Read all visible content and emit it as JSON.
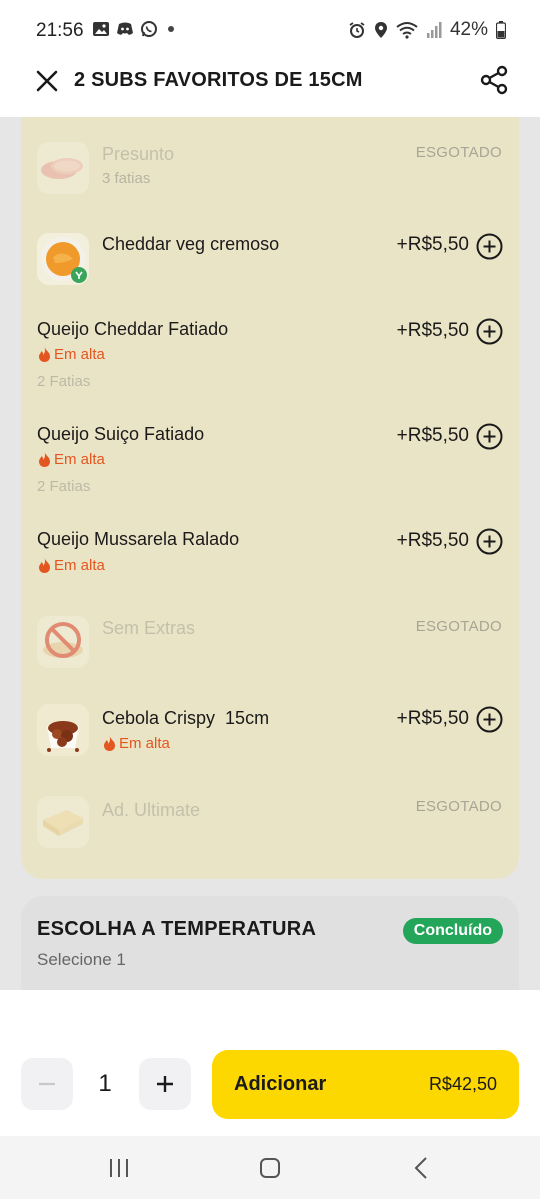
{
  "status_bar": {
    "time": "21:56",
    "battery": "42%",
    "icons": [
      "gallery-icon",
      "discord-icon",
      "whatsapp-icon",
      "alarm-icon",
      "location-icon",
      "wifi-icon",
      "signal-icon",
      "battery-icon"
    ]
  },
  "header": {
    "title": "2 SUBS FAVORITOS DE 15CM",
    "close_icon": "close-icon",
    "share_icon": "share-icon"
  },
  "options": [
    {
      "name": "Presunto",
      "sub": "3 fatias",
      "status": "ESGOTADO",
      "icon": "ham-image"
    },
    {
      "name": "Cheddar veg cremoso",
      "price": "+R$5,50",
      "icon": "cheddar-veg-image"
    },
    {
      "name": "Queijo Cheddar Fatiado",
      "trend": "Em alta",
      "sub": "2 Fatias",
      "price": "+R$5,50"
    },
    {
      "name": "Queijo Suiço Fatiado",
      "trend": "Em alta",
      "sub": "2 Fatias",
      "price": "+R$5,50"
    },
    {
      "name": "Queijo Mussarela Ralado",
      "trend": "Em alta",
      "price": "+R$5,50"
    },
    {
      "name": "Sem Extras",
      "status": "ESGOTADO",
      "icon": "no-extras-image"
    },
    {
      "name": "Cebola Crispy  15cm",
      "trend": "Em alta",
      "price": "+R$5,50",
      "icon": "crispy-onion-image"
    },
    {
      "name": "Ad. Ultimate",
      "status": "ESGOTADO",
      "icon": "ultimate-image"
    }
  ],
  "temperature": {
    "title": "ESCOLHA A TEMPERATURA",
    "subtitle": "Selecione 1",
    "badge": "Concluído"
  },
  "footer": {
    "quantity": "1",
    "add_label": "Adicionar",
    "add_price": "R$42,50"
  },
  "colors": {
    "accent_yellow": "#fcd800",
    "card_bg": "#eae4c6",
    "trend_orange": "#e4561f",
    "badge_green": "#23a55a"
  }
}
